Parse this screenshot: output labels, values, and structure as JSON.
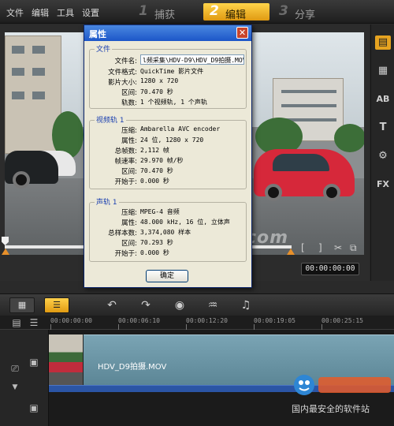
{
  "menu": {
    "file": "文件",
    "edit": "编辑",
    "tools": "工具",
    "settings": "设置"
  },
  "steps": [
    {
      "num": "1",
      "label": "捕获",
      "active": false
    },
    {
      "num": "2",
      "label": "编辑",
      "active": true
    },
    {
      "num": "3",
      "label": "分享",
      "active": false
    }
  ],
  "dialog": {
    "title": "属性",
    "file_group": "文件",
    "file_rows": [
      {
        "key": "文件名:",
        "value": "l频采集\\HDV-D9\\HDV_D9拍摄.MOV"
      },
      {
        "key": "文件格式:",
        "value": "QuickTime 影片文件"
      },
      {
        "key": "影片大小:",
        "value": "1280 x 720"
      },
      {
        "key": "区间:",
        "value": "70.470 秒"
      },
      {
        "key": "轨数:",
        "value": "1 个视频轨, 1 个声轨"
      }
    ],
    "video_group": "视频轨 1",
    "video_rows": [
      {
        "key": "压缩:",
        "value": "Ambarella AVC encoder"
      },
      {
        "key": "属性:",
        "value": "24 位, 1280 x 720"
      },
      {
        "key": "总帧数:",
        "value": "2,112 帧"
      },
      {
        "key": "帧速率:",
        "value": "29.970 帧/秒"
      },
      {
        "key": "区间:",
        "value": "70.470 秒"
      },
      {
        "key": "开始于:",
        "value": "0.000 秒"
      }
    ],
    "audio_group": "声轨 1",
    "audio_rows": [
      {
        "key": "压缩:",
        "value": "MPEG-4 音频"
      },
      {
        "key": "属性:",
        "value": "48.000 kHz, 16 位, 立体声"
      },
      {
        "key": "总样本数:",
        "value": "3,374,080 样本"
      },
      {
        "key": "区间:",
        "value": "70.293 秒"
      },
      {
        "key": "开始于:",
        "value": "0.000 秒"
      }
    ],
    "ok": "确定"
  },
  "transport": {
    "mark_in": "[",
    "mark_out": "]",
    "timecode": "00:00:00:00"
  },
  "timeline": {
    "ruler": [
      "00:00:00:00",
      "00:00:06:10",
      "00:00:12:20",
      "00:00:19:05",
      "00:00:25:15"
    ],
    "clip_name": "HDV_D9拍摄.MOV"
  },
  "watermark": "@OuoTe.com",
  "brand": {
    "sub": "国内最安全的软件站"
  },
  "icons": {
    "right_strip": [
      "media-library-icon",
      "instant-project-icon",
      "title-icon",
      "text-icon",
      "transition-icon",
      "filter-fx-icon"
    ],
    "toolbar": [
      "storyboard-view-icon",
      "timeline-view-icon",
      "undo-icon",
      "redo-icon",
      "record-capture-icon",
      "sound-mixer-icon",
      "auto-music-icon"
    ]
  },
  "colors": {
    "accent": "#e6a320",
    "dialog_bg": "#ece9d8",
    "clip": "#6a94a4",
    "audio": "#2b55a5"
  }
}
